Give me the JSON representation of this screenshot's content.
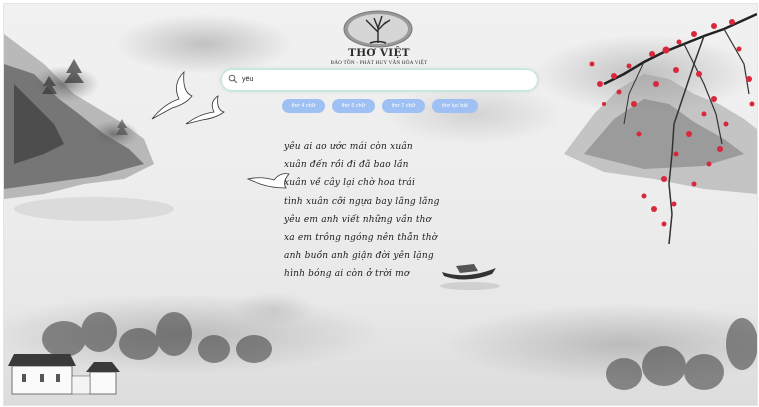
{
  "brand": {
    "title": "THƠ VIỆT",
    "subtitle": "BẢO TỒN - PHÁT HUY VĂN HÓA VIỆT"
  },
  "search": {
    "value": "yêu",
    "icon": "search-icon"
  },
  "categories": [
    {
      "label": "thơ 4 chữ"
    },
    {
      "label": "thơ 5 chữ"
    },
    {
      "label": "thơ 7 chữ"
    },
    {
      "label": "thơ lục bát"
    }
  ],
  "poem": {
    "lines": [
      "yêu ai ao ước mái còn xuân",
      "xuân đến rồi đi đã bao lần",
      "xuân về cây lại chờ hoa trái",
      "tình xuân cỡi ngựa bay lãng lãng",
      "yêu em anh viết những vần thơ",
      "xa em trông ngóng nên thẫn thờ",
      "anh buồn anh giận đời yên lặng",
      "hình bóng ai còn ở trời mơ"
    ]
  },
  "colors": {
    "chip": "#9fc0f2",
    "search_border": "#bfe7da",
    "blossom": "#d8283c",
    "ink": "#2c2c2c"
  }
}
